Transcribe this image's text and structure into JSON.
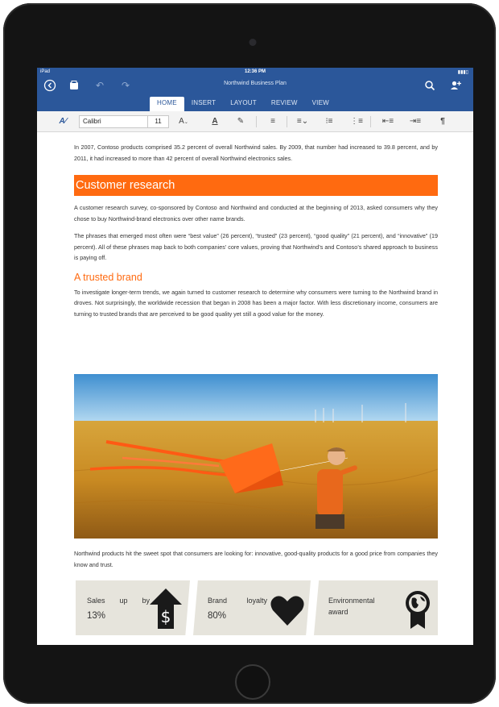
{
  "status_bar": {
    "carrier": "iPad",
    "time": "12:36 PM",
    "battery": ""
  },
  "document_title": "Northwind Business Plan",
  "ribbon_tabs": [
    "HOME",
    "INSERT",
    "LAYOUT",
    "REVIEW",
    "VIEW"
  ],
  "toolbar": {
    "font_name": "Calibri",
    "font_size": "11"
  },
  "body": {
    "intro": "In 2007, Contoso products comprised 35.2 percent of overall Northwind sales. By 2009, that number had increased to 39.8 percent, and by 2011, it had increased to more than 42 percent of overall Northwind electronics sales.",
    "heading": "Customer research",
    "survey": "A customer research survey, co-sponsored by Contoso and Northwind and conducted at the beginning of 2013, asked consumers why they chose to buy Northwind-brand electronics over other name brands.",
    "phrases": "The phrases that emerged most often were “best value” (26 percent), “trusted” (23 percent), “good quality” (21 percent), and “innovative” (19 percent). All of these phrases map back to both companies’ core values, proving that Northwind’s and Contoso’s shared approach to business is paying off.",
    "subheading": "A trusted brand",
    "trusted": "To investigate longer-term trends, we again turned to customer research to determine why consumers were turning to the Northwind brand in droves. Not surprisingly, the worldwide recession that began in 2008 has been a major factor. With less discretionary income, consumers are turning to trusted brands that are perceived to be good quality yet still a good value for the money.",
    "caption": "Northwind products hit the sweet spot that consumers are looking for: innovative, good-quality products for a good price from companies they know and trust."
  },
  "info_tiles": [
    {
      "label": "Sales up by",
      "value": "13%",
      "icon": "dollar-up-arrow-icon"
    },
    {
      "label": "Brand loyalty",
      "value": "80%",
      "icon": "heart-icon"
    },
    {
      "label": "Environmental award",
      "value": "",
      "icon": "globe-ribbon-award-icon"
    }
  ],
  "colors": {
    "ribbon": "#2b579a",
    "accent": "#ff6a10",
    "tile": "#e6e4dc"
  }
}
